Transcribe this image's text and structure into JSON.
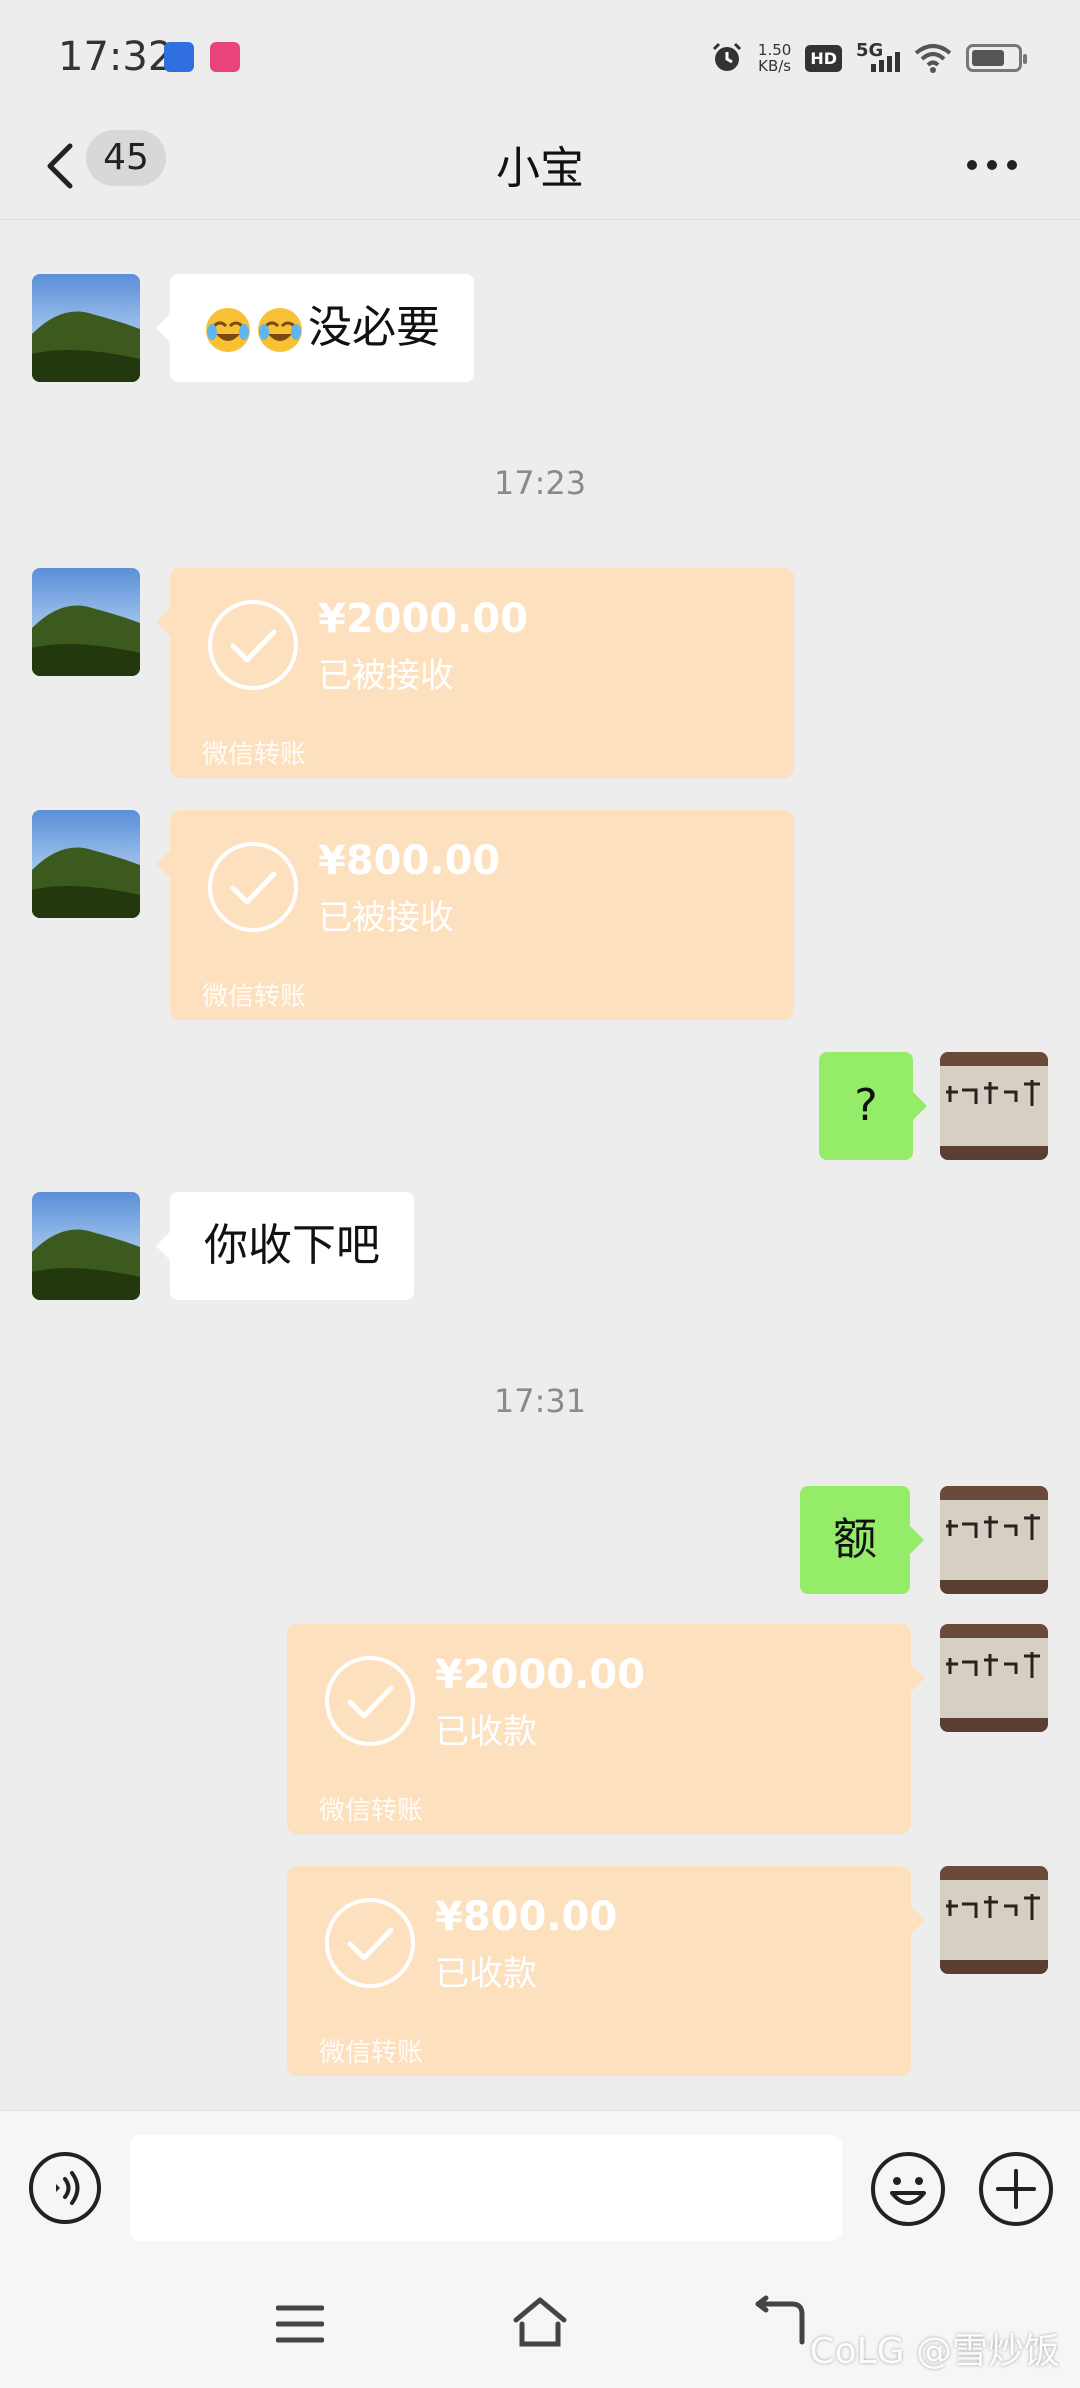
{
  "status_bar": {
    "time": "17:32",
    "net_speed_value": "1.50",
    "net_speed_unit": "KB/s",
    "hd_label": "HD",
    "network_label": "5G"
  },
  "header": {
    "unread_count": "45",
    "title": "小宝"
  },
  "messages": {
    "m1_text": "没必要",
    "ts1": "17:23",
    "t1": {
      "amount": "¥2000.00",
      "status": "已被接收",
      "footer": "微信转账"
    },
    "t2": {
      "amount": "¥800.00",
      "status": "已被接收",
      "footer": "微信转账"
    },
    "m2_text": "?",
    "m3_text": "你收下吧",
    "ts2": "17:31",
    "m4_text": "额",
    "t3": {
      "amount": "¥2000.00",
      "status": "已收款",
      "footer": "微信转账"
    },
    "t4": {
      "amount": "¥800.00",
      "status": "已收款",
      "footer": "微信转账"
    }
  },
  "input": {
    "value": "",
    "placeholder": ""
  },
  "watermark": "CoLG @雪炒饭",
  "icons": {
    "back": "back-icon",
    "more": "more-icon",
    "check": "check-circle-icon",
    "voice": "voice-icon",
    "emoji": "emoji-icon",
    "plus": "plus-icon",
    "menu": "menu-icon",
    "home": "home-icon",
    "nav_back": "nav-back-icon"
  },
  "colors": {
    "background": "#ededed",
    "sent_bubble": "#95ec69",
    "received_bubble": "#ffffff",
    "transfer_done": "#fde0bd"
  }
}
